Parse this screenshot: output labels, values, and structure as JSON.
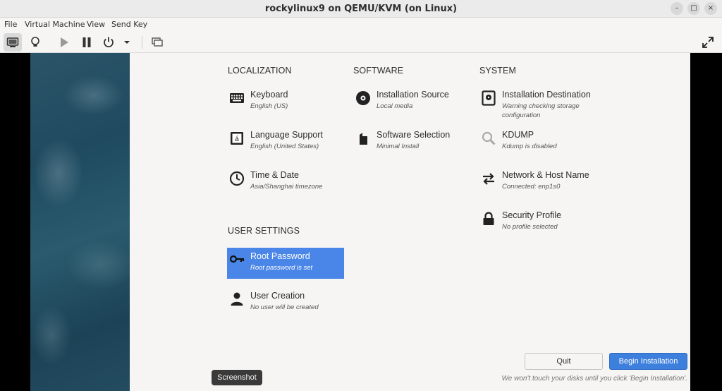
{
  "window": {
    "title": "rockylinux9 on QEMU/KVM (on Linux)",
    "min_icon": "minimize-icon",
    "max_icon": "maximize-icon",
    "close_icon": "close-icon",
    "min_glyph": "–",
    "max_glyph": "□",
    "close_glyph": "×"
  },
  "menubar": [
    "File",
    "Virtual Machine",
    "View",
    "Send Key"
  ],
  "toolbar": {
    "icons": [
      "console-icon",
      "details-lightbulb-icon",
      "run-play-icon",
      "pause-icon",
      "power-icon",
      "dropdown-arrow-icon",
      "snapshots-icon",
      "fullscreen-icon"
    ]
  },
  "hub": {
    "categories": {
      "localization": "LOCALIZATION",
      "software": "SOFTWARE",
      "system": "SYSTEM",
      "user_settings": "USER SETTINGS"
    },
    "spokes": {
      "keyboard": {
        "label": "Keyboard",
        "status": "English (US)",
        "icon": "keyboard-icon"
      },
      "language": {
        "label": "Language Support",
        "status": "English (United States)",
        "icon": "language-icon"
      },
      "time": {
        "label": "Time & Date",
        "status": "Asia/Shanghai timezone",
        "icon": "clock-icon"
      },
      "source": {
        "label": "Installation Source",
        "status": "Local media",
        "icon": "disc-icon"
      },
      "software_selection": {
        "label": "Software Selection",
        "status": "Minimal Install",
        "icon": "package-icon"
      },
      "destination": {
        "label": "Installation Destination",
        "status": "Warning checking storage configuration",
        "icon": "harddisk-icon"
      },
      "kdump": {
        "label": "KDUMP",
        "status": "Kdump is disabled",
        "icon": "magnifier-icon"
      },
      "network": {
        "label": "Network & Host Name",
        "status": "Connected: enp1s0",
        "icon": "network-arrows-icon"
      },
      "security": {
        "label": "Security Profile",
        "status": "No profile selected",
        "icon": "lock-icon"
      },
      "root": {
        "label": "Root Password",
        "status": "Root password is set",
        "icon": "key-icon"
      },
      "user": {
        "label": "User Creation",
        "status": "No user will be created",
        "icon": "user-icon"
      }
    },
    "buttons": {
      "quit": "Quit",
      "begin": "Begin Installation"
    },
    "note": "We won't touch your disks until you click 'Begin Installation'."
  },
  "tooltip": "Screenshot",
  "colors": {
    "accent": "#3d7fdc",
    "selected": "#4a86e8"
  }
}
